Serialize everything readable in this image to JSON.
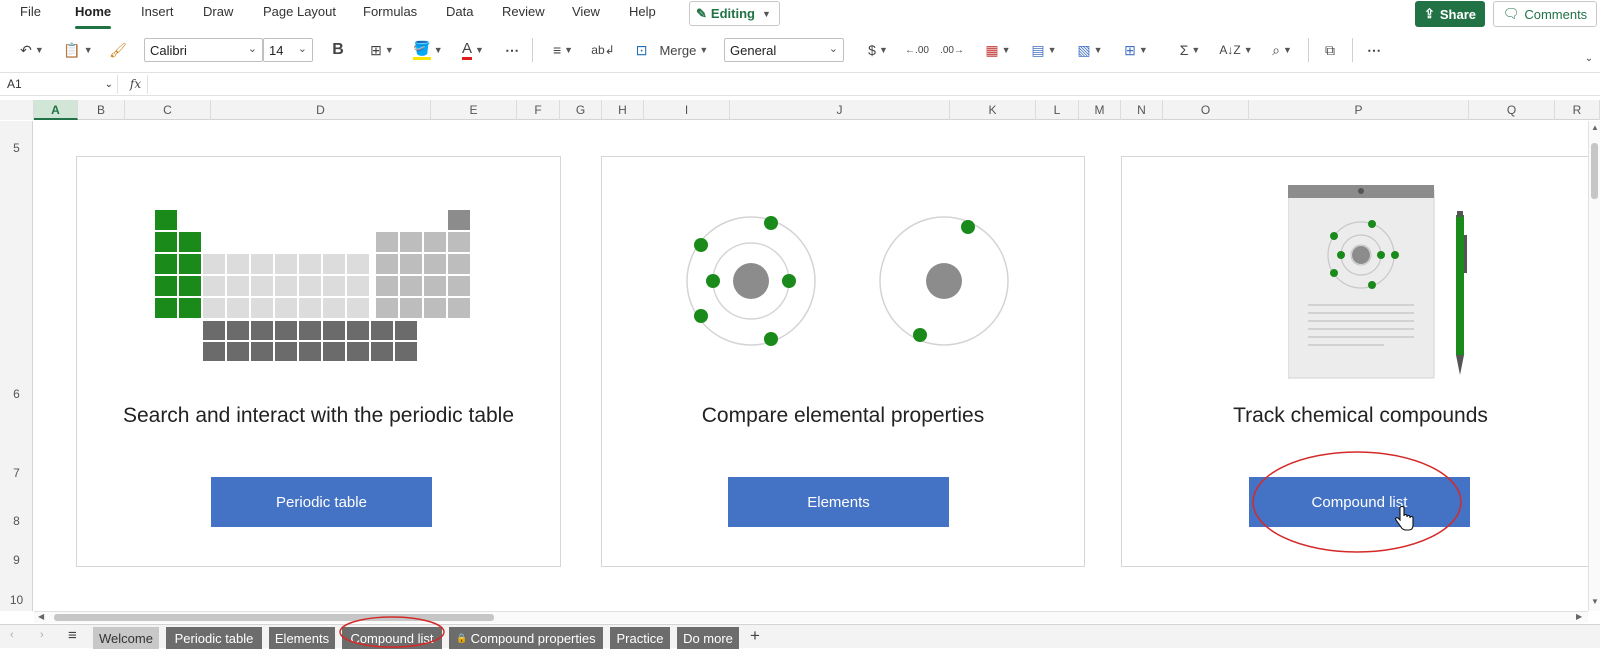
{
  "menu": {
    "items": [
      "File",
      "Home",
      "Insert",
      "Draw",
      "Page Layout",
      "Formulas",
      "Data",
      "Review",
      "View",
      "Help"
    ],
    "active": "Home",
    "editing_label": "Editing",
    "share_label": "Share",
    "comments_label": "Comments"
  },
  "ribbon": {
    "font_name": "Calibri",
    "font_size": "14",
    "bold_label": "B",
    "font_color_label": "A",
    "more_label": "⋯",
    "merge_label": "Merge",
    "number_format": "General",
    "currency_label": "$"
  },
  "formula_bar": {
    "name_box": "A1",
    "fx_label": "fx",
    "formula": ""
  },
  "columns": [
    "A",
    "B",
    "C",
    "D",
    "E",
    "F",
    "G",
    "H",
    "I",
    "J",
    "K",
    "L",
    "M",
    "N",
    "O",
    "P",
    "Q",
    "R"
  ],
  "selected_column": "A",
  "rows": [
    "5",
    "6",
    "7",
    "8",
    "9",
    "10"
  ],
  "cards": [
    {
      "title": "Search and interact with the periodic table",
      "button": "Periodic table"
    },
    {
      "title": "Compare elemental properties",
      "button": "Elements"
    },
    {
      "title": "Track chemical compounds",
      "button": "Compound list"
    }
  ],
  "sheet_tabs": [
    "Welcome",
    "Periodic table",
    "Elements",
    "Compound list",
    "Compound properties",
    "Practice",
    "Do more"
  ],
  "active_tab": "Welcome",
  "colors": {
    "accent_green": "#217346",
    "button_blue": "#4472c4",
    "element_green": "#1a8a1a",
    "highlight_red": "#d42a2a"
  }
}
